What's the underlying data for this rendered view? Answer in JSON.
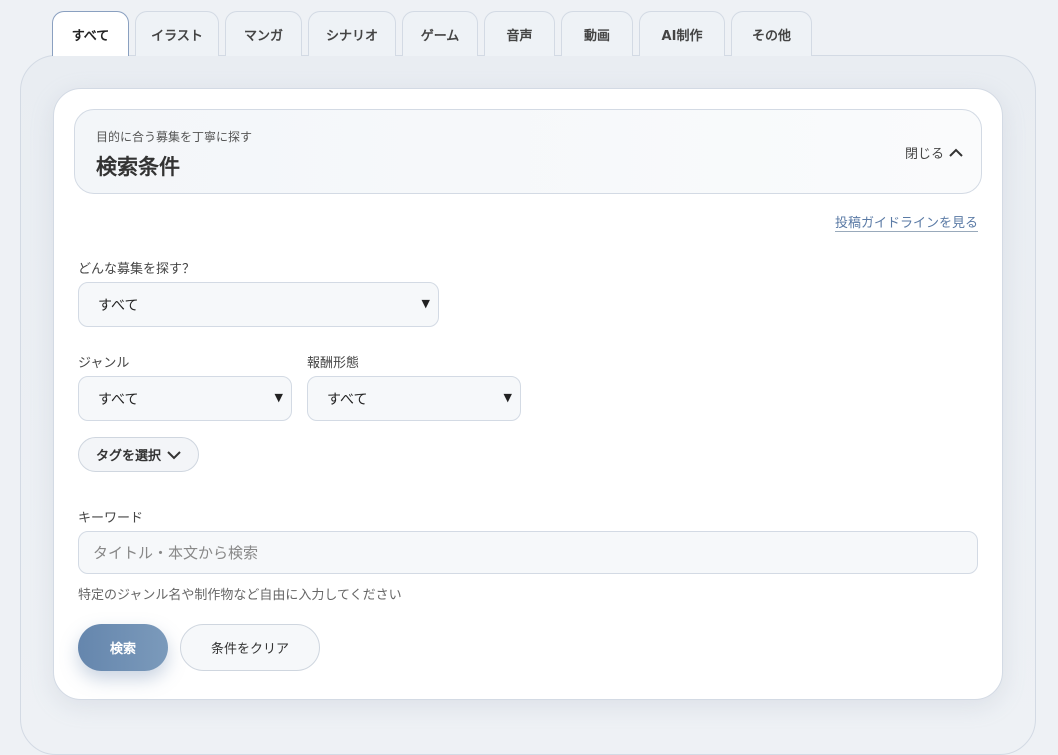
{
  "tabs": [
    "すべて",
    "イラスト",
    "マンガ",
    "シナリオ",
    "ゲーム",
    "音声",
    "動画",
    "AI制作",
    "その他"
  ],
  "header": {
    "subtitle": "目的に合う募集を丁寧に探す",
    "title": "検索条件",
    "close_label": "閉じる"
  },
  "guideline_link": "投稿ガイドラインを見る",
  "type_filter": {
    "label": "どんな募集を探す？",
    "value": "すべて"
  },
  "genre_filter": {
    "label": "ジャンル",
    "value": "すべて"
  },
  "reward_filter": {
    "label": "報酬形態",
    "value": "すべて"
  },
  "tag_button": "タグを選択",
  "keyword": {
    "label": "キーワード",
    "placeholder": "タイトル・本文から検索",
    "hint": "特定のジャンル名や制作物など自由に入力してください"
  },
  "search_button": "検索",
  "clear_button": "条件をクリア"
}
